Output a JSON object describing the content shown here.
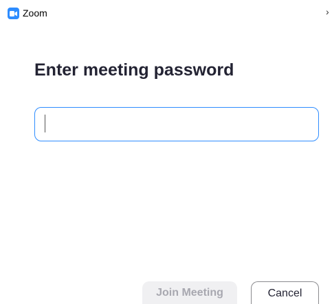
{
  "window": {
    "app_title": "Zoom",
    "app_icon": "zoom-video-icon",
    "title_chevron": "›"
  },
  "dialog": {
    "heading": "Enter meeting password",
    "password_value": "",
    "password_placeholder": ""
  },
  "buttons": {
    "join_label": "Join Meeting",
    "join_enabled": false,
    "cancel_label": "Cancel"
  },
  "colors": {
    "accent": "#2d8cff",
    "heading": "#232333",
    "disabled_text": "#a8a8b0"
  }
}
